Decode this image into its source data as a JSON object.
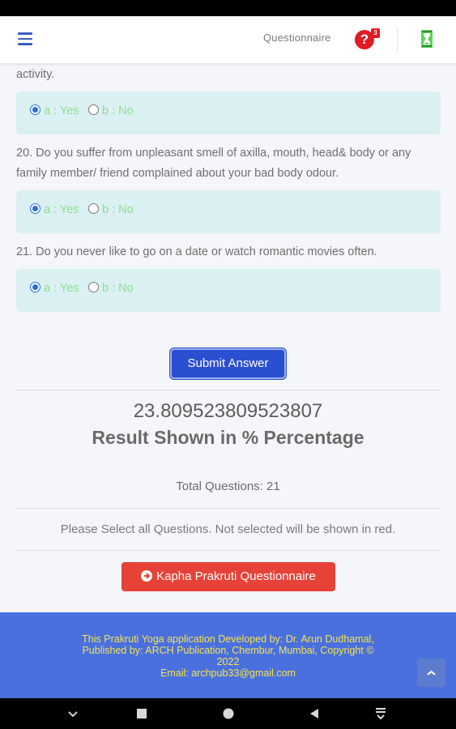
{
  "header": {
    "title": "Questionnaire",
    "help_badge": "3",
    "icons": [
      "menu-icon",
      "help-icon",
      "hourglass-icon"
    ]
  },
  "questions": [
    {
      "text": "activity.",
      "option_a": "a : Yes",
      "option_b": "b : No",
      "selected": "a"
    },
    {
      "text": "20. Do you suffer from unpleasant smell of axilla, mouth, head& body or any family member/ friend complained about your bad body odour.",
      "option_a": "a : Yes",
      "option_b": "b : No",
      "selected": "a"
    },
    {
      "text": "21. Do you never like to go on a date or watch romantic movies often.",
      "option_a": "a : Yes",
      "option_b": "b : No",
      "selected": "a"
    }
  ],
  "submit_label": "Submit Answer",
  "result": {
    "value": "23.809523809523807",
    "caption": "Result Shown in % Percentage",
    "total_questions": "Total Questions: 21",
    "notice": "Please Select all Questions. Not selected will be shown in red."
  },
  "kapha_button_label": "Kapha Prakruti Questionnaire",
  "footer": {
    "line1": "This Prakruti Yoga application Developed by: Dr. Arun Dudhamal,",
    "line2": "Published by: ARCH Publication, Chembur, Mumbai, Copyright ©",
    "line3": "2022",
    "line4": "Email: archpub33@gmail.com"
  },
  "colors": {
    "brand_blue": "#2b4fd1",
    "footer_blue": "#4a70de",
    "danger_red": "#e64238",
    "option_green": "#8fe08a",
    "footer_text_yellow": "#f4e34e",
    "answer_bg": "#daf0f3"
  }
}
